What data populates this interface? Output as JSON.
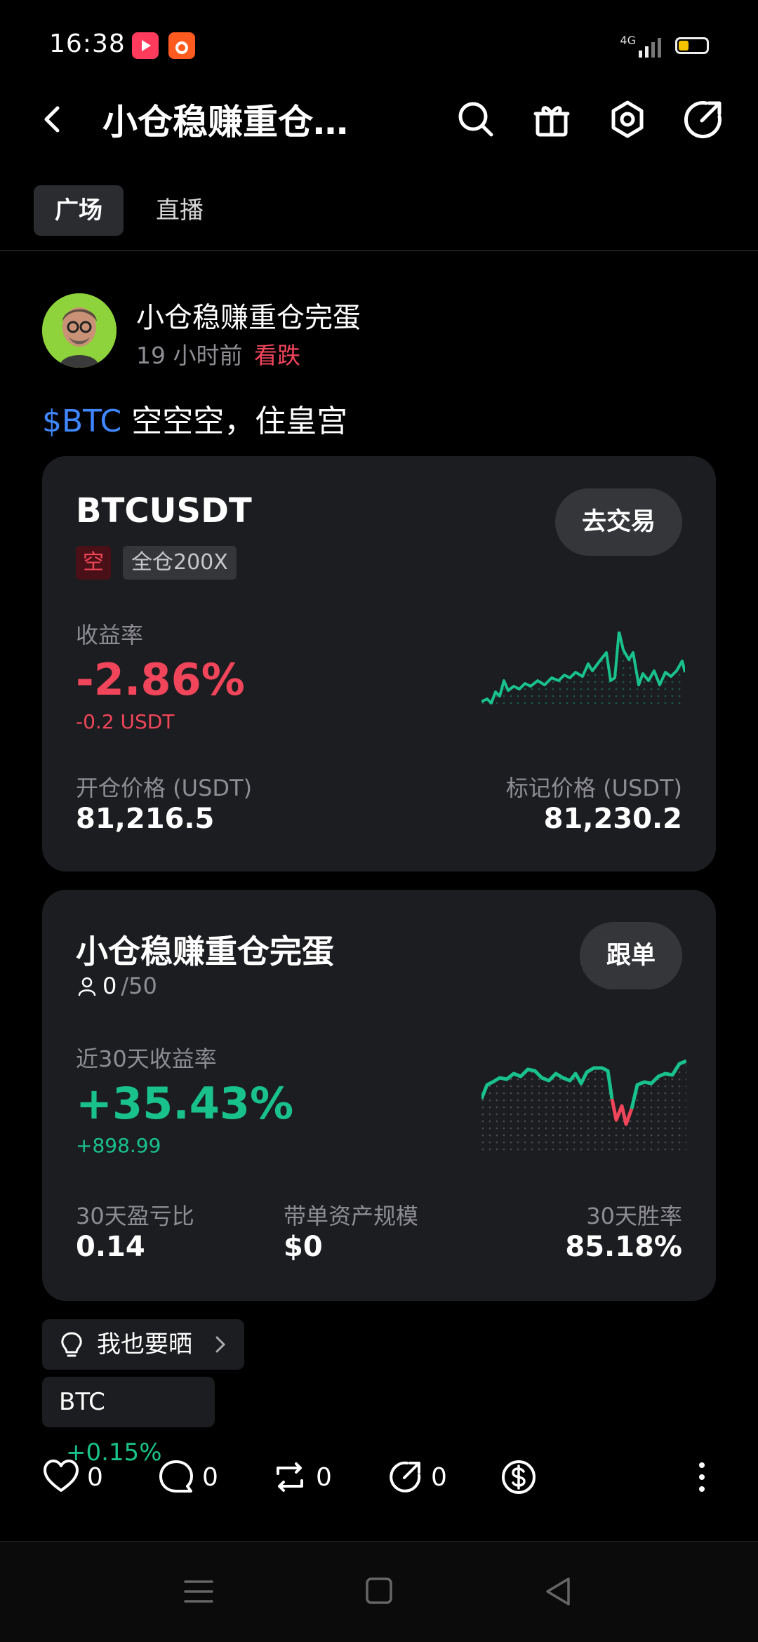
{
  "status_bar": {
    "time": "16:38",
    "network": "4G"
  },
  "header": {
    "title": "小仓稳赚重仓…"
  },
  "tabs": [
    {
      "label": "广场",
      "active": true
    },
    {
      "label": "直播",
      "active": false
    }
  ],
  "post": {
    "author": "小仓稳赚重仓完蛋",
    "time": "19 小时前",
    "sentiment": "看跌",
    "tag": "$BTC",
    "text": " 空空空，住皇宫"
  },
  "position_card": {
    "symbol": "BTCUSDT",
    "side": "空",
    "leverage": "全仓200X",
    "trade_button": "去交易",
    "pnl_label": "收益率",
    "pnl_percent": "-2.86%",
    "pnl_amount": "-0.2 USDT",
    "open_price_label": "开仓价格 (USDT)",
    "open_price": "81,216.5",
    "mark_price_label": "标记价格 (USDT)",
    "mark_price": "81,230.2"
  },
  "trader_card": {
    "name": "小仓稳赚重仓完蛋",
    "followers_current": "0",
    "followers_max": "/50",
    "follow_button": "跟单",
    "roi_label": "近30天收益率",
    "roi": "+35.43%",
    "pnl": "+898.99",
    "ratio_label": "30天盈亏比",
    "ratio": "0.14",
    "aum_label": "带单资产规模",
    "aum": "$0",
    "winrate_label": "30天胜率",
    "winrate": "85.18%"
  },
  "chips": {
    "share": "我也要晒",
    "ticker": "BTC",
    "ticker_change": "+0.15%"
  },
  "actions": {
    "likes": "0",
    "comments": "0",
    "reposts": "0",
    "shares": "0"
  },
  "colors": {
    "up": "#19c28b",
    "down": "#f0455a",
    "link": "#3f86ff",
    "card": "#1c1d20"
  }
}
